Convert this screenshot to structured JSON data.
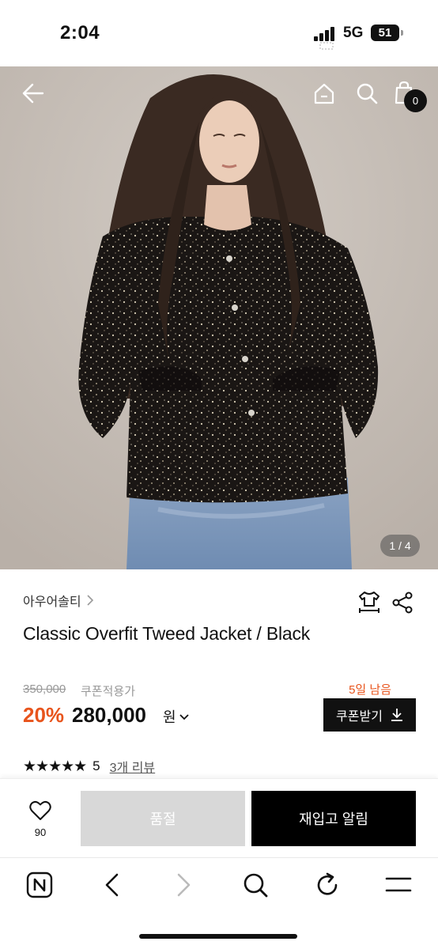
{
  "status_bar": {
    "time": "2:04",
    "network": "5G",
    "battery": "51"
  },
  "header": {
    "cart_count": "0"
  },
  "gallery": {
    "indicator": "1 / 4"
  },
  "product": {
    "brand": "아우어솔티",
    "title": "Classic Overfit Tweed Jacket / Black",
    "original_price": "350,000",
    "coupon_label": "쿠폰적용가",
    "discount": "20%",
    "price": "280,000",
    "currency": "원",
    "days_left": "5일 남음",
    "coupon_button": "쿠폰받기",
    "rating_stars": "★★★★★",
    "rating": "5",
    "review_link": "3개 리뷰"
  },
  "actions": {
    "like_count": "90",
    "soldout": "품절",
    "restock": "재입고 알림"
  },
  "colors": {
    "accent": "#e8541c",
    "primary": "#111111",
    "disabled": "#d8d8d8"
  }
}
